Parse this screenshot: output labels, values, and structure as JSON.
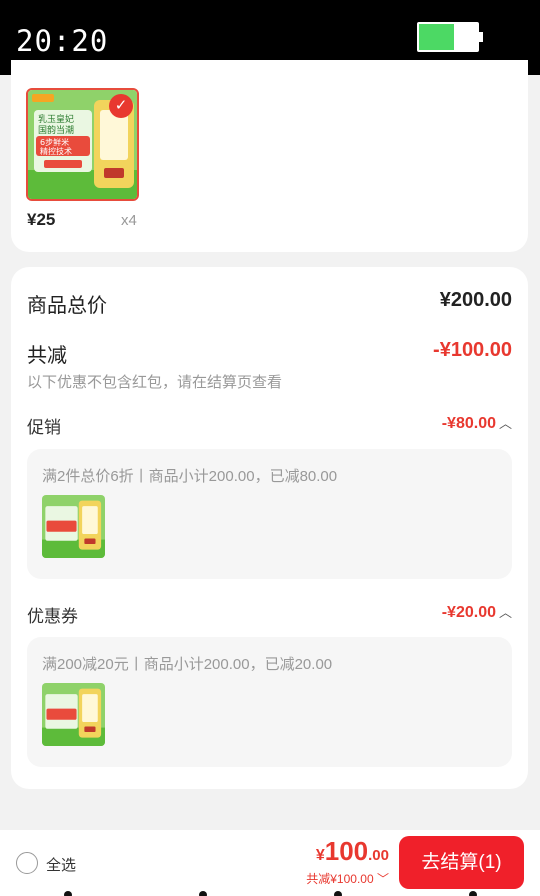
{
  "status_bar": {
    "time": "20:20",
    "battery_level": 0.6,
    "battery_color": "#4cd964"
  },
  "product": {
    "price": "¥25",
    "quantity": "x4",
    "selected": true,
    "thumb_texts": [
      "乳玉皇妃",
      "国韵当潮",
      "6步鲜米",
      "精控技术"
    ]
  },
  "summary": {
    "total_label": "商品总价",
    "total_value": "¥200.00",
    "discount_label": "共减",
    "discount_value": "-¥100.00",
    "note": "以下优惠不包含红包，请在结算页查看",
    "promotion": {
      "label": "促销",
      "value": "-¥80.00",
      "description": "满2件总价6折丨商品小计200.00，已减80.00"
    },
    "coupon": {
      "label": "优惠券",
      "value": "-¥20.00",
      "description": "满200减20元丨商品小计200.00，已减20.00"
    }
  },
  "bottom_bar": {
    "select_all_label": "全选",
    "total_currency": "¥",
    "total_integer": "100",
    "total_decimal": ".00",
    "saved_text": "共减¥100.00",
    "checkout_label": "去结算(1)"
  },
  "colors": {
    "accent": "#e8382f",
    "checkout": "#f0202a",
    "background": "#f2f2f2"
  },
  "icons": {
    "check": "check-icon",
    "chevron_up": "chevron-up-icon",
    "chevron_down": "chevron-down-icon"
  }
}
